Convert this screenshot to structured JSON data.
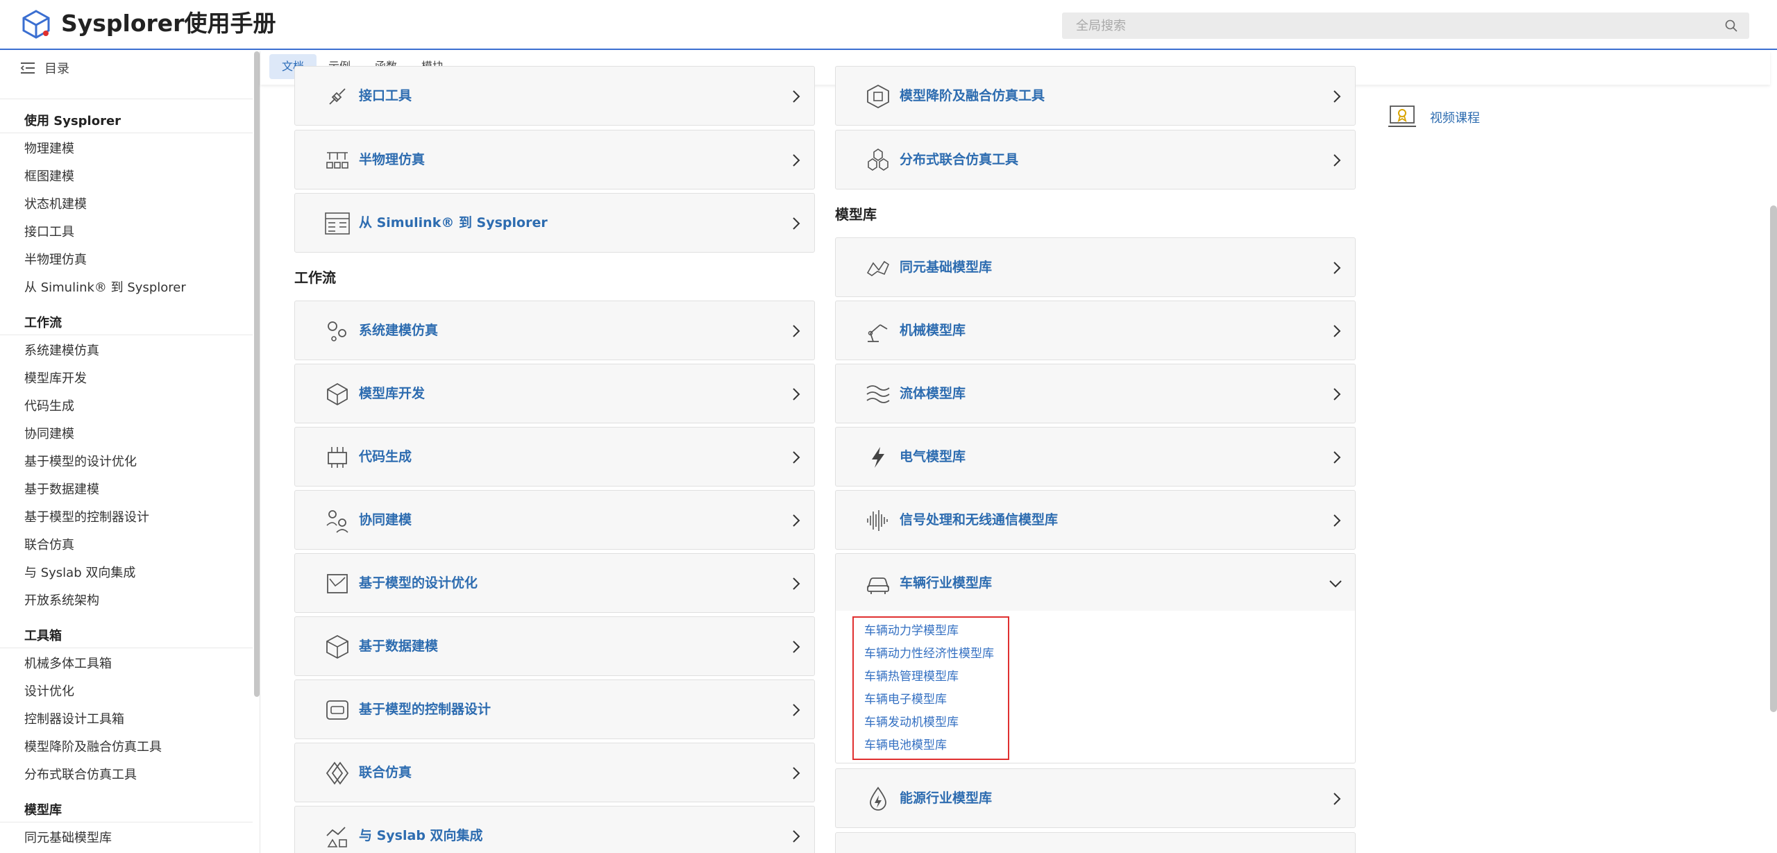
{
  "header": {
    "title": "Sysplorer使用手册",
    "search_placeholder": "全局搜索"
  },
  "sidebar": {
    "toc_label": "目录",
    "groups": [
      {
        "title": "使用 Sysplorer",
        "items": [
          "物理建模",
          "框图建模",
          "状态机建模",
          "接口工具",
          "半物理仿真",
          "从 Simulink® 到 Sysplorer"
        ]
      },
      {
        "title": "工作流",
        "items": [
          "系统建模仿真",
          "模型库开发",
          "代码生成",
          "协同建模",
          "基于模型的设计优化",
          "基于数据建模",
          "基于模型的控制器设计",
          "联合仿真",
          "与 Syslab 双向集成",
          "开放系统架构"
        ]
      },
      {
        "title": "工具箱",
        "items": [
          "机械多体工具箱",
          "设计优化",
          "控制器设计工具箱",
          "模型降阶及融合仿真工具",
          "分布式联合仿真工具"
        ]
      },
      {
        "title": "模型库",
        "items": [
          "同元基础模型库"
        ]
      }
    ]
  },
  "tabs": [
    "文档",
    "示例",
    "函数",
    "模块"
  ],
  "main": {
    "left_top_cards": [
      "接口工具",
      "半物理仿真",
      "从 Simulink® 到 Sysplorer"
    ],
    "workflow_title": "工作流",
    "workflow_cards": [
      "系统建模仿真",
      "模型库开发",
      "代码生成",
      "协同建模",
      "基于模型的设计优化",
      "基于数据建模",
      "基于模型的控制器设计",
      "联合仿真",
      "与 Syslab 双向集成"
    ],
    "right_top_cards": [
      "模型降阶及融合仿真工具",
      "分布式联合仿真工具"
    ],
    "library_title": "模型库",
    "library_cards": [
      "同元基础模型库",
      "机械模型库",
      "流体模型库",
      "电气模型库",
      "信号处理和无线通信模型库",
      "车辆行业模型库",
      "能源行业模型库"
    ],
    "vehicle_sublinks": [
      "车辆动力学模型库",
      "车辆动力性经济性模型库",
      "车辆热管理模型库",
      "车辆电子模型库",
      "车辆发动机模型库",
      "车辆电池模型库"
    ]
  },
  "right_panel": {
    "video_link": "视频课程"
  },
  "colors": {
    "accent": "#2d6cb0",
    "header_border": "#3b6fd1",
    "highlight": "#e03030"
  }
}
